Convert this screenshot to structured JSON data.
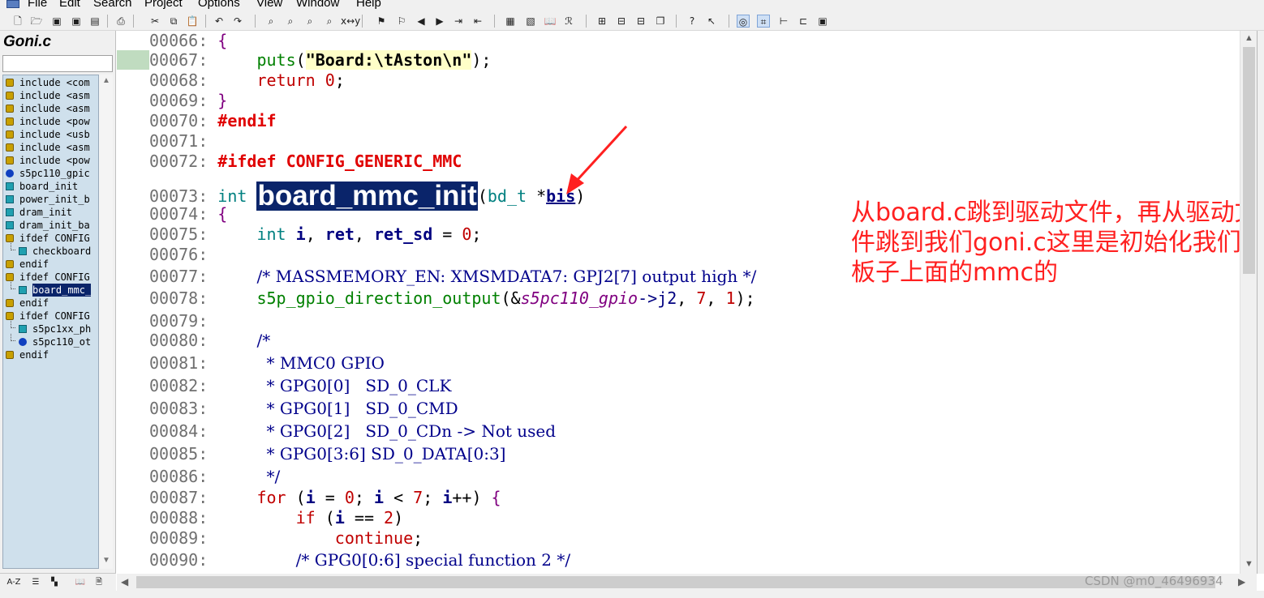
{
  "menu": [
    "File",
    "Edit",
    "Search",
    "Project",
    "Options",
    "View",
    "Window",
    "Help"
  ],
  "toolbar_icons": [
    "new-file-icon",
    "open-file-icon",
    "save-icon",
    "save-all-icon",
    "close-file-icon",
    "print-icon",
    "undo-icon",
    "redo-icon",
    "cut-icon",
    "copy-icon",
    "paste-icon",
    "search-icon",
    "search-files-icon",
    "search-project-icon",
    "lookup-references-icon",
    "replace-icon",
    "bookmark-add-icon",
    "bookmark-remove-icon",
    "back-icon",
    "forward-icon",
    "jump-to-definition-icon",
    "jump-to-caller-icon",
    "project-window-icon",
    "symbol-window-icon",
    "context-window-icon",
    "relation-window-icon",
    "tile-horizontal-icon",
    "tile-vertical-icon",
    "cascade-icon",
    "restore-window-icon",
    "help-icon",
    "pointer-help-icon",
    "toggle-view-icon",
    "browse-symbols-icon",
    "tree-icon",
    "graph-icon",
    "info-icon"
  ],
  "left_panel": {
    "file_title": "Goni.c",
    "symbols": [
      {
        "icon": "include",
        "label": "include <com",
        "indent": 0
      },
      {
        "icon": "include",
        "label": "include <asm",
        "indent": 0
      },
      {
        "icon": "include",
        "label": "include <asm",
        "indent": 0
      },
      {
        "icon": "include",
        "label": "include <pow",
        "indent": 0
      },
      {
        "icon": "include",
        "label": "include <usb",
        "indent": 0
      },
      {
        "icon": "include",
        "label": "include <asm",
        "indent": 0
      },
      {
        "icon": "include",
        "label": "include <pow",
        "indent": 0
      },
      {
        "icon": "var",
        "label": "s5pc110_gpic",
        "indent": 0
      },
      {
        "icon": "func",
        "label": "board_init",
        "indent": 0
      },
      {
        "icon": "func",
        "label": "power_init_b",
        "indent": 0
      },
      {
        "icon": "func",
        "label": "dram_init",
        "indent": 0
      },
      {
        "icon": "func",
        "label": "dram_init_ba",
        "indent": 0
      },
      {
        "icon": "ifdef",
        "label": "ifdef CONFIG",
        "indent": 0
      },
      {
        "icon": "func",
        "label": "checkboard",
        "indent": 1
      },
      {
        "icon": "ifdef",
        "label": "endif",
        "indent": 0
      },
      {
        "icon": "ifdef",
        "label": "ifdef CONFIG",
        "indent": 0
      },
      {
        "icon": "func",
        "label": "board_mmc_",
        "indent": 1,
        "selected": true
      },
      {
        "icon": "ifdef",
        "label": "endif",
        "indent": 0
      },
      {
        "icon": "ifdef",
        "label": "ifdef CONFIG",
        "indent": 0
      },
      {
        "icon": "func",
        "label": "s5pc1xx_ph",
        "indent": 1
      },
      {
        "icon": "var",
        "label": "s5pc110_ot",
        "indent": 1
      },
      {
        "icon": "ifdef",
        "label": "endif",
        "indent": 0
      }
    ],
    "bottom_icons": [
      "sort-alpha-icon",
      "list-view-icon",
      "category-view-icon",
      "book-icon",
      "properties-icon"
    ],
    "sort_label": "A-Z"
  },
  "code": [
    {
      "n": "00066:",
      "t": [
        [
          "{",
          "brace"
        ]
      ]
    },
    {
      "n": "00067:",
      "t": [
        [
          "    ",
          "punc"
        ],
        [
          "puts",
          "func"
        ],
        [
          "(",
          "punc"
        ],
        [
          "\"Board:\\tAston\\n\"",
          "str"
        ],
        [
          ");",
          "punc"
        ]
      ]
    },
    {
      "n": "00068:",
      "t": [
        [
          "    ",
          "punc"
        ],
        [
          "return",
          "kw"
        ],
        [
          " ",
          "punc"
        ],
        [
          "0",
          "num"
        ],
        [
          ";",
          "punc"
        ]
      ]
    },
    {
      "n": "00069:",
      "t": [
        [
          "}",
          "brace"
        ]
      ]
    },
    {
      "n": "00070:",
      "t": [
        [
          "#endif",
          "pre"
        ]
      ]
    },
    {
      "n": "00071:",
      "t": []
    },
    {
      "n": "00072:",
      "t": [
        [
          "#ifdef CONFIG_GENERIC_MMC",
          "pre"
        ]
      ]
    },
    {
      "n": "00073:",
      "t": [
        [
          "int",
          "type"
        ],
        [
          " ",
          "punc"
        ],
        [
          "board_mmc_init",
          "select"
        ],
        [
          "(",
          "punc"
        ],
        [
          "bd_t",
          "type"
        ],
        [
          " *",
          "punc"
        ],
        [
          "bis",
          "param"
        ],
        [
          ")",
          "punc"
        ]
      ]
    },
    {
      "n": "00074:",
      "t": [
        [
          "{",
          "brace"
        ]
      ]
    },
    {
      "n": "00075:",
      "t": [
        [
          "    ",
          "punc"
        ],
        [
          "int",
          "type"
        ],
        [
          " ",
          "punc"
        ],
        [
          "i",
          "var"
        ],
        [
          ", ",
          "punc"
        ],
        [
          "ret",
          "var"
        ],
        [
          ", ",
          "punc"
        ],
        [
          "ret_sd",
          "var"
        ],
        [
          " = ",
          "punc"
        ],
        [
          "0",
          "num"
        ],
        [
          ";",
          "punc"
        ]
      ]
    },
    {
      "n": "00076:",
      "t": []
    },
    {
      "n": "00077:",
      "t": [
        [
          "    ",
          "punc"
        ],
        [
          "/* MASSMEMORY_EN: XMSMDATA7: GPJ2[7] output high */",
          "comment"
        ]
      ]
    },
    {
      "n": "00078:",
      "t": [
        [
          "    ",
          "punc"
        ],
        [
          "s5p_gpio_direction_output",
          "func"
        ],
        [
          "(&",
          "punc"
        ],
        [
          "s5pc110_gpio",
          "ital"
        ],
        [
          "->",
          "arrow"
        ],
        [
          "j2",
          "field"
        ],
        [
          ", ",
          "punc"
        ],
        [
          "7",
          "num"
        ],
        [
          ", ",
          "punc"
        ],
        [
          "1",
          "num"
        ],
        [
          ");",
          "punc"
        ]
      ]
    },
    {
      "n": "00079:",
      "t": []
    },
    {
      "n": "00080:",
      "t": [
        [
          "    ",
          "punc"
        ],
        [
          "/*",
          "comment"
        ]
      ]
    },
    {
      "n": "00081:",
      "t": [
        [
          "     ",
          "punc"
        ],
        [
          "* MMC0 GPIO",
          "comment"
        ]
      ]
    },
    {
      "n": "00082:",
      "t": [
        [
          "     ",
          "punc"
        ],
        [
          "* GPG0[0]   SD_0_CLK",
          "comment"
        ]
      ]
    },
    {
      "n": "00083:",
      "t": [
        [
          "     ",
          "punc"
        ],
        [
          "* GPG0[1]   SD_0_CMD",
          "comment"
        ]
      ]
    },
    {
      "n": "00084:",
      "t": [
        [
          "     ",
          "punc"
        ],
        [
          "* GPG0[2]   SD_0_CDn -> Not used",
          "comment"
        ]
      ]
    },
    {
      "n": "00085:",
      "t": [
        [
          "     ",
          "punc"
        ],
        [
          "* GPG0[3:6] SD_0_DATA[0:3]",
          "comment"
        ]
      ]
    },
    {
      "n": "00086:",
      "t": [
        [
          "     ",
          "punc"
        ],
        [
          "*/",
          "comment"
        ]
      ]
    },
    {
      "n": "00087:",
      "t": [
        [
          "    ",
          "punc"
        ],
        [
          "for",
          "kw"
        ],
        [
          " (",
          "punc"
        ],
        [
          "i",
          "var"
        ],
        [
          " = ",
          "punc"
        ],
        [
          "0",
          "num"
        ],
        [
          "; ",
          "punc"
        ],
        [
          "i",
          "var"
        ],
        [
          " < ",
          "punc"
        ],
        [
          "7",
          "num"
        ],
        [
          "; ",
          "punc"
        ],
        [
          "i",
          "var"
        ],
        [
          "++) ",
          "punc"
        ],
        [
          "{",
          "brace"
        ]
      ]
    },
    {
      "n": "00088:",
      "t": [
        [
          "        ",
          "punc"
        ],
        [
          "if",
          "kw"
        ],
        [
          " (",
          "punc"
        ],
        [
          "i",
          "var"
        ],
        [
          " == ",
          "punc"
        ],
        [
          "2",
          "num"
        ],
        [
          ")",
          "punc"
        ]
      ]
    },
    {
      "n": "00089:",
      "t": [
        [
          "            ",
          "punc"
        ],
        [
          "continue",
          "kw"
        ],
        [
          ";",
          "punc"
        ]
      ]
    },
    {
      "n": "00090:",
      "t": [
        [
          "        ",
          "punc"
        ],
        [
          "/* GPG0[0:6] special function 2 */",
          "comment"
        ]
      ]
    }
  ],
  "annotation": "从board.c跳到驱动文件，再从驱动文件跳到我们goni.c这里是初始化我们板子上面的mmc的",
  "watermark": "CSDN @m0_46496934"
}
